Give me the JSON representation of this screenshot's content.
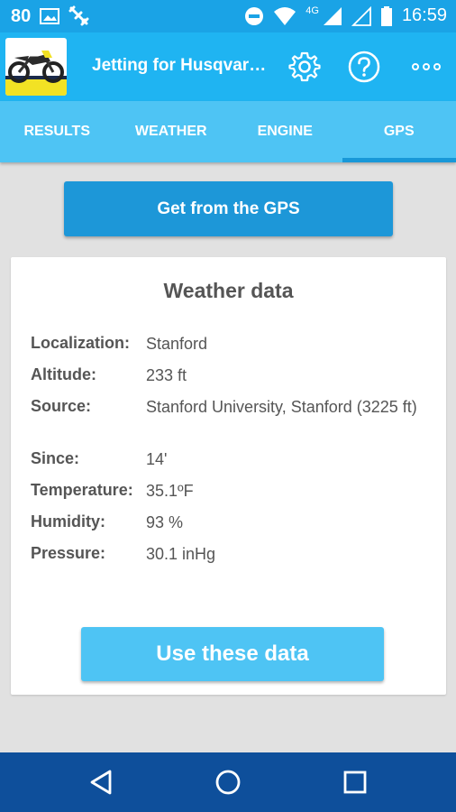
{
  "status_bar": {
    "battery_level": "80",
    "network": "4G",
    "time": "16:59",
    "icons": [
      "image-icon",
      "satellite-icon",
      "do-not-disturb-icon",
      "wifi-icon",
      "signal-icon",
      "signal-empty-icon",
      "battery-icon"
    ]
  },
  "app_bar": {
    "title": "Jetting for Husqvar…",
    "logo": "dirt-bike-logo",
    "actions": [
      "settings-icon",
      "help-icon",
      "more-options-icon"
    ]
  },
  "tabs": [
    {
      "label": "RESULTS",
      "active": false
    },
    {
      "label": "WEATHER",
      "active": false
    },
    {
      "label": "ENGINE",
      "active": false
    },
    {
      "label": "GPS",
      "active": true
    }
  ],
  "gps_button": {
    "label": "Get from the GPS"
  },
  "weather_card": {
    "title": "Weather data",
    "rows": [
      {
        "label": "Localization:",
        "value": "Stanford"
      },
      {
        "label": "Altitude:",
        "value": "233 ft"
      },
      {
        "label": "Source:",
        "value": "Stanford University, Stanford (3225 ft)"
      },
      {
        "label": "Since:",
        "value": "14'"
      },
      {
        "label": "Temperature:",
        "value": "35.1ºF"
      },
      {
        "label": "Humidity:",
        "value": "93 %"
      },
      {
        "label": "Pressure:",
        "value": "30.1 inHg"
      }
    ],
    "use_button": {
      "label": "Use these data"
    }
  },
  "nav_bar": {
    "buttons": [
      "back-icon",
      "home-icon",
      "recents-icon"
    ]
  },
  "colors": {
    "status_bar": "#1aa3e6",
    "app_bar": "#1fb4f2",
    "tabs": "#4ec4f4",
    "tab_indicator": "#1898d8",
    "primary_button": "#1d97d8",
    "nav_bar": "#0e4f9b"
  }
}
